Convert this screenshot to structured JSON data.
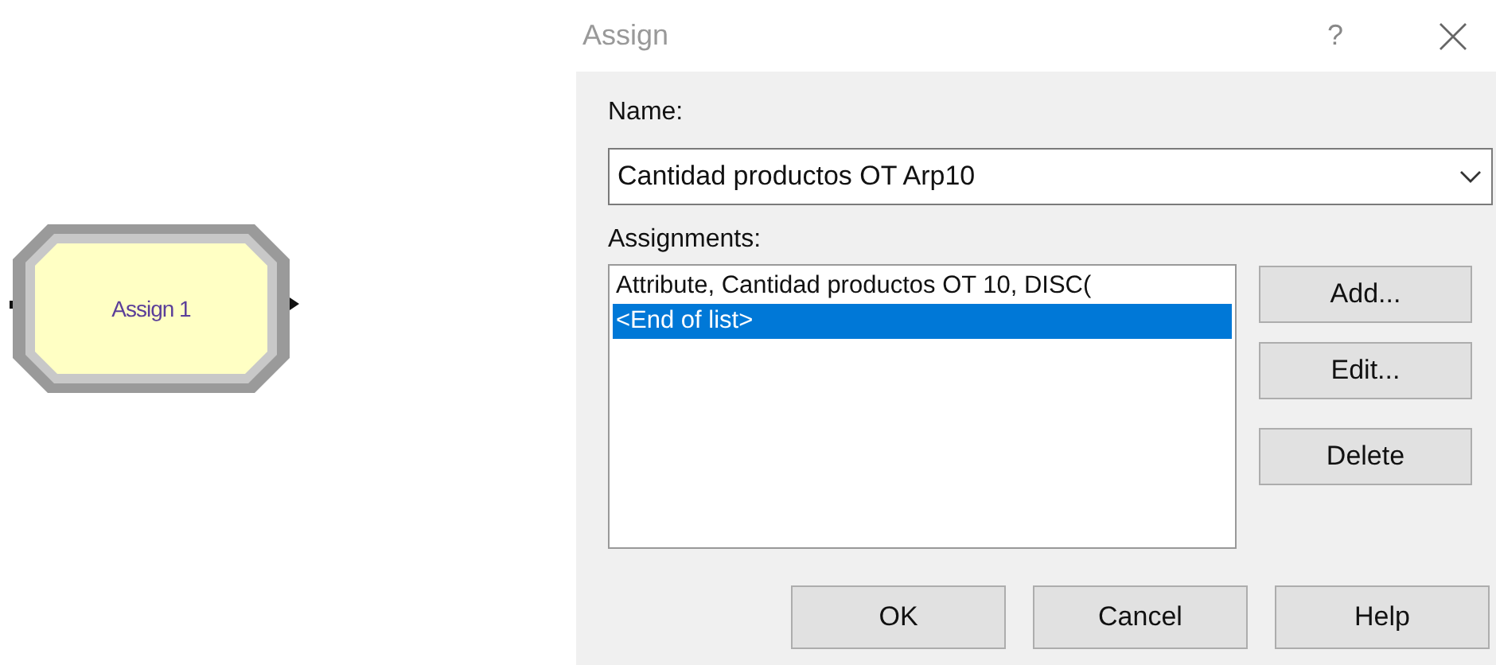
{
  "module": {
    "label": "Assign 1"
  },
  "dialog": {
    "title": "Assign",
    "help_glyph": "?",
    "name_label": "Name:",
    "name_value": "Cantidad productos OT Arp10",
    "assignments_label": "Assignments:",
    "assignments": [
      {
        "text": "Attribute, Cantidad productos OT 10, DISC(",
        "selected": false
      },
      {
        "text": "<End of list>",
        "selected": true
      }
    ],
    "side_buttons": [
      "Add...",
      "Edit...",
      "Delete"
    ],
    "bottom_buttons": [
      "OK",
      "Cancel",
      "Help"
    ]
  }
}
